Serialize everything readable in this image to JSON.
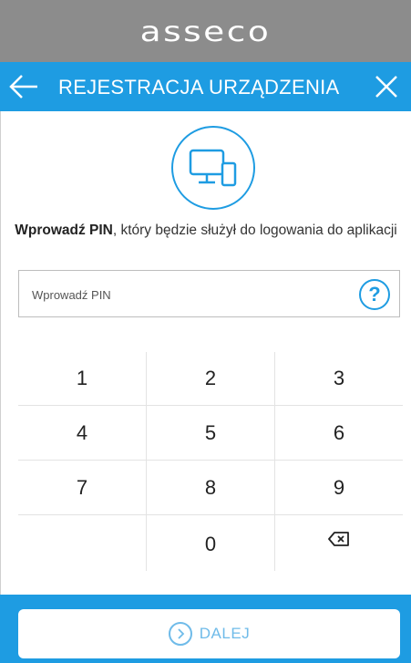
{
  "brand": {
    "logo_text": "asseco"
  },
  "nav": {
    "title": "REJESTRACJA URZĄDZENIA",
    "back_icon": "arrow-left-icon",
    "close_icon": "close-icon"
  },
  "device_icon": "desktop-and-phone-icon",
  "instruction": {
    "bold": "Wprowadź PIN",
    "rest": ", który będzie służył do logowania do aplikacji"
  },
  "pin_input": {
    "placeholder": "Wprowadź PIN",
    "value": "",
    "help_label": "?"
  },
  "keypad": {
    "keys": [
      "1",
      "2",
      "3",
      "4",
      "5",
      "6",
      "7",
      "8",
      "9",
      "",
      "0",
      "⌫"
    ],
    "backspace_icon": "backspace-icon"
  },
  "footer": {
    "next_label": "DALEJ",
    "next_icon": "chevron-right-circle-icon"
  },
  "colors": {
    "accent": "#1e9ce2",
    "brand_bar": "#8c8c8c",
    "button_text": "#6fbbe9"
  }
}
